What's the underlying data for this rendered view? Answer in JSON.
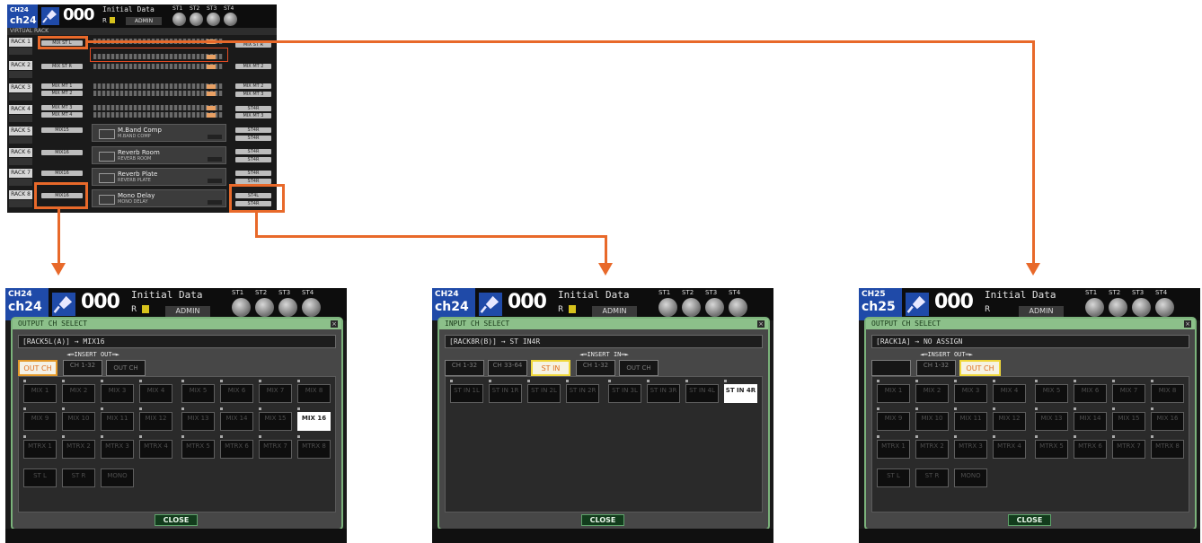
{
  "rack_screen": {
    "header": {
      "ch_id": "CH24",
      "ch_name": "ch24",
      "scene_number": "000",
      "scene_title": "Initial Data",
      "scene_r": "R",
      "user": "ADMIN",
      "knob_labels": [
        "ST1",
        "ST2",
        "ST3",
        "ST4"
      ]
    },
    "tab": "VIRTUAL RACK",
    "racks": [
      "RACK 1",
      "RACK 2",
      "RACK 3",
      "RACK 4",
      "RACK 5",
      "RACK 6",
      "RACK 7",
      "RACK 8"
    ],
    "input_buttons": [
      "MIX ST L",
      "MIX ST R",
      "MIX MT 1",
      "MIX MT 2",
      "MIX MT 3",
      "MIX MT 4",
      "MIX15",
      "MIX16",
      "MIX16",
      "MIX16"
    ],
    "output_buttons": [
      "MIX ST R",
      "MIX MT 2",
      "MIX MT 3",
      "ST4R",
      "ST4R",
      "ST4R",
      "ST4R",
      "ST4R",
      "ST4R",
      "ST4R",
      "ST4R"
    ],
    "effects": [
      {
        "name": "M.Band Comp",
        "type": "M.BAND COMP"
      },
      {
        "name": "Reverb Room",
        "type": "REVERB ROOM"
      },
      {
        "name": "Reverb Plate",
        "type": "REVERB PLATE"
      },
      {
        "name": "Mono Delay",
        "type": "MONO DELAY"
      }
    ],
    "highlight_input": "MIX16",
    "highlight_output": [
      "ST4L",
      "ST4R"
    ]
  },
  "windows": [
    {
      "header": {
        "ch_id": "CH24",
        "ch_name": "ch24",
        "scene_number": "000",
        "scene_title": "Initial Data",
        "scene_r": "R",
        "user": "ADMIN",
        "knob_labels": [
          "ST1",
          "ST2",
          "ST3",
          "ST4"
        ]
      },
      "title": "OUTPUT CH SELECT",
      "path": "[RACK5L(A)] → MIX16",
      "insert_label": "INSERT OUT",
      "categories": [
        "OUT CH",
        "CH 1-32",
        "OUT CH"
      ],
      "grid": [
        [
          "MIX 1",
          "MIX 2",
          "MIX 3",
          "MIX 4",
          "MIX 5",
          "MIX 6",
          "MIX 7",
          "MIX 8"
        ],
        [
          "MIX 9",
          "MIX 10",
          "MIX 11",
          "MIX 12",
          "MIX 13",
          "MIX 14",
          "MIX 15",
          "MIX 16"
        ],
        [
          "MTRX 1",
          "MTRX 2",
          "MTRX 3",
          "MTRX 4",
          "MTRX 5",
          "MTRX 6",
          "MTRX 7",
          "MTRX 8"
        ],
        [
          "ST L",
          "ST R",
          "MONO"
        ]
      ],
      "selected": "MIX 16",
      "close": "CLOSE"
    },
    {
      "header": {
        "ch_id": "CH24",
        "ch_name": "ch24",
        "scene_number": "000",
        "scene_title": "Initial Data",
        "scene_r": "R",
        "user": "ADMIN",
        "knob_labels": [
          "ST1",
          "ST2",
          "ST3",
          "ST4"
        ]
      },
      "title": "INPUT CH SELECT",
      "path": "[RACK8R(B)] → ST IN4R",
      "insert_label": "INSERT IN",
      "categories": [
        "CH 1-32",
        "CH 33-64",
        "ST IN",
        "CH 1-32",
        "OUT CH"
      ],
      "grid": [
        [
          "ST IN 1L",
          "ST IN 1R",
          "ST IN 2L",
          "ST IN 2R",
          "ST IN 3L",
          "ST IN 3R",
          "ST IN 4L",
          "ST IN 4R"
        ]
      ],
      "selected": "ST IN 4R",
      "close": "CLOSE"
    },
    {
      "header": {
        "ch_id": "CH25",
        "ch_name": "ch25",
        "scene_number": "000",
        "scene_title": "Initial Data",
        "scene_r": "R",
        "user": "ADMIN",
        "knob_labels": [
          "ST1",
          "ST2",
          "ST3",
          "ST4"
        ]
      },
      "title": "OUTPUT CH SELECT",
      "path": "[RACK1A] → NO ASSIGN",
      "insert_label": "INSERT OUT",
      "categories": [
        "",
        "CH 1-32",
        "OUT CH"
      ],
      "grid": [
        [
          "MIX 1",
          "MIX 2",
          "MIX 3",
          "MIX 4",
          "MIX 5",
          "MIX 6",
          "MIX 7",
          "MIX 8"
        ],
        [
          "MIX 9",
          "MIX 10",
          "MIX 11",
          "MIX 12",
          "MIX 13",
          "MIX 14",
          "MIX 15",
          "MIX 16"
        ],
        [
          "MTRX 1",
          "MTRX 2",
          "MTRX 3",
          "MTRX 4",
          "MTRX 5",
          "MTRX 6",
          "MTRX 7",
          "MTRX 8"
        ],
        [
          "ST L",
          "ST R",
          "MONO"
        ]
      ],
      "selected": "",
      "close": "CLOSE"
    }
  ],
  "colors": {
    "annotation": "#e8692a",
    "dialog_border": "#7bb27b",
    "header_ch": "#1f4aa8"
  }
}
